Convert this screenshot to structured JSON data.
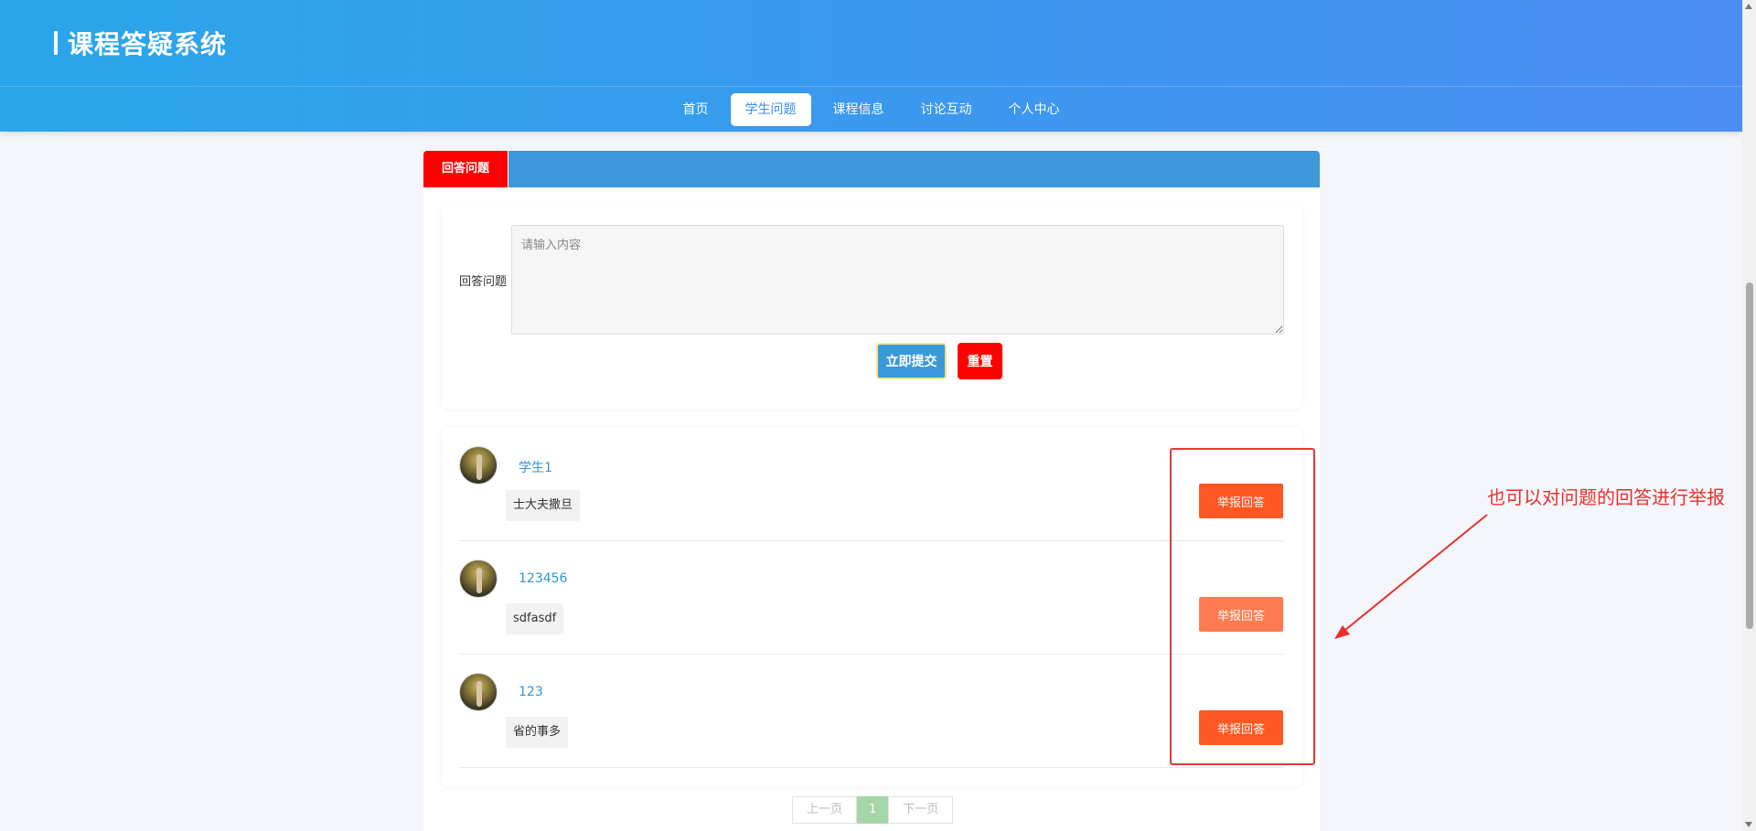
{
  "header": {
    "title": "课程答疑系统"
  },
  "nav": {
    "items": [
      {
        "label": "首页"
      },
      {
        "label": "学生问题"
      },
      {
        "label": "课程信息"
      },
      {
        "label": "讨论互动"
      },
      {
        "label": "个人中心"
      }
    ],
    "active": "学生问题"
  },
  "panel": {
    "tab_label": "回答问题"
  },
  "form": {
    "label": "回答问题",
    "placeholder": "请输入内容",
    "value": "",
    "submit_label": "立即提交",
    "reset_label": "重置"
  },
  "answers": [
    {
      "name": "学生1",
      "text": "士大夫撒旦",
      "report_label": "举报回答"
    },
    {
      "name": "123456",
      "text": "sdfasdf",
      "report_label": "举报回答"
    },
    {
      "name": "123",
      "text": "省的事多",
      "report_label": "举报回答"
    }
  ],
  "pager": {
    "prev_label": "上一页",
    "current": "1",
    "next_label": "下一页"
  },
  "annotation": {
    "text": "也可以对问题的回答进行举报",
    "color": "#e8302c"
  },
  "colors": {
    "header_gradient_start": "#2aa6ea",
    "header_gradient_end": "#4b8ef2",
    "panel_head": "#3c97db",
    "tab_red": "#ff0000",
    "report_orange": "#ff5722",
    "link_blue": "#2f95d6"
  }
}
